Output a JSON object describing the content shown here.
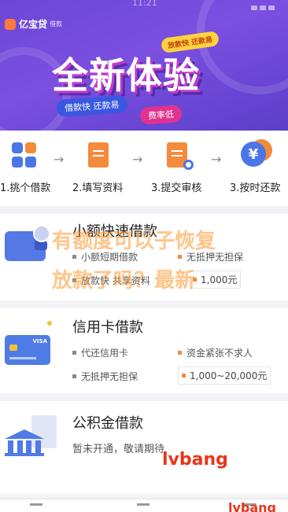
{
  "status_bar": {
    "time": "11:21"
  },
  "banner": {
    "app_name": "亿宝贷",
    "app_sub": "借款",
    "tagline": "放款快 还款易",
    "title": "全新体验",
    "pill_a": "借款快 还款易",
    "pill_b": "费率低"
  },
  "steps": [
    {
      "label": "1.挑个借款",
      "icon": "apps-grid-icon"
    },
    {
      "label": "2.填写资料",
      "icon": "document-icon"
    },
    {
      "label": "3.提交审核",
      "icon": "document-search-icon"
    },
    {
      "label": "3.按时还款",
      "icon": "yen-coin-icon"
    }
  ],
  "products": [
    {
      "title": "小额快速借款",
      "features": [
        "小额短期借款",
        "无抵押无担保",
        "放款快 共享资料"
      ],
      "amount": "1,000元",
      "icon": "wallet-icon"
    },
    {
      "title": "信用卡借款",
      "features": [
        "代还信用卡",
        "资金紧张不求人",
        "无抵押无担保"
      ],
      "amount": "1,000~20,000元",
      "icon": "credit-card-icon"
    },
    {
      "title": "公积金借款",
      "features": [
        "暂未开通，敬请期待"
      ],
      "icon": "bank-icon"
    }
  ],
  "watermark": {
    "line1": "有额度可以子恢复",
    "line2": "放款了吗？最新",
    "brand": "lvbang",
    "brand2": "lvbang"
  },
  "colors": {
    "banner": "#6c47d6",
    "accent_blue": "#4a76e8",
    "accent_orange": "#f28a3a"
  }
}
